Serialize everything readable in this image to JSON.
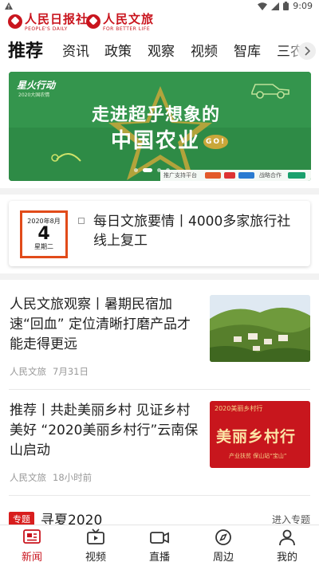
{
  "status": {
    "time": "9:09"
  },
  "logos": {
    "left": {
      "zh": "人民日报社",
      "en": "PEOPLE'S DAILY"
    },
    "right": {
      "zh": "人民文旅",
      "en": "FOR BETTER LIFE"
    }
  },
  "tabs": [
    "推荐",
    "资讯",
    "政策",
    "观察",
    "视频",
    "智库",
    "三农"
  ],
  "banner": {
    "tag": "星火行动",
    "subtag": "2020大国农情",
    "headline1": "走进超乎想象的",
    "headline2": "中国农业",
    "headline_badge": "GO!",
    "sponsor_label": "推广支持平台",
    "partner_label": "战略合作",
    "page_count": 4,
    "active_page": 1
  },
  "daily": {
    "date_ym": "2020年8月",
    "date_day": "4",
    "date_weekday": "星期二",
    "title": "每日文旅要情丨4000多家旅行社线上复工"
  },
  "news": [
    {
      "title": "人民文旅观察丨暑期民宿加速“回血” 定位清晰打磨产品才能走得更远",
      "source": "人民文旅",
      "time": "7月31日",
      "thumb": "village-hillside"
    },
    {
      "title": "推荐丨共赴美丽乡村 见证乡村美好 “2020美丽乡村行”云南保山启动",
      "source": "人民文旅",
      "time": "18小时前",
      "thumb": "red-poster",
      "thumb_text": "美丽乡村行",
      "thumb_sub": "产业扶贫 保山站“宝山”",
      "thumb_top": "2020美丽乡村行"
    }
  ],
  "topic": {
    "badge": "专题",
    "name": "寻夏2020",
    "enter": "进入专题"
  },
  "bottom_nav": [
    {
      "label": "新闻",
      "icon": "news-icon",
      "active": true
    },
    {
      "label": "视频",
      "icon": "tv-icon",
      "active": false
    },
    {
      "label": "直播",
      "icon": "live-camera-icon",
      "active": false
    },
    {
      "label": "周边",
      "icon": "compass-icon",
      "active": false
    },
    {
      "label": "我的",
      "icon": "user-icon",
      "active": false
    }
  ],
  "colors": {
    "accent": "#c9151e",
    "date_border": "#e14b1a",
    "banner_green": "#2e8b46"
  }
}
